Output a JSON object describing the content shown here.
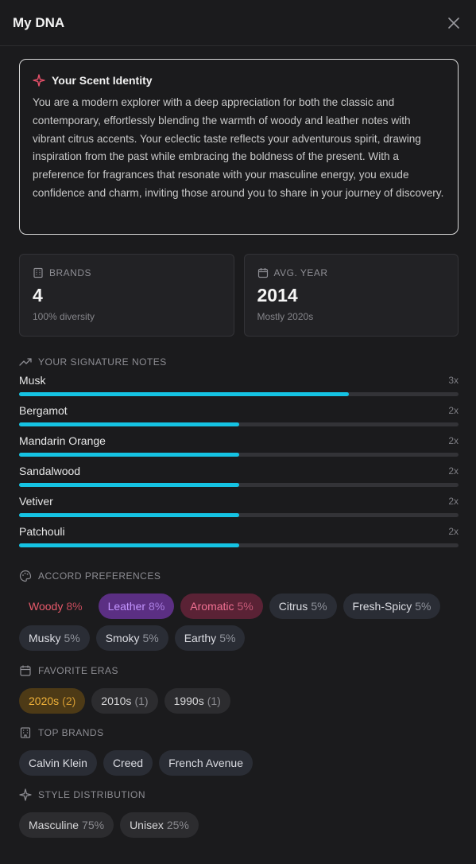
{
  "header": {
    "title": "My DNA"
  },
  "identity": {
    "title": "Your Scent Identity",
    "text": "You are a modern explorer with a deep appreciation for both the classic and contemporary, effortlessly blending the warmth of woody and leather notes with vibrant citrus accents. Your eclectic taste reflects your adventurous spirit, drawing inspiration from the past while embracing the boldness of the present. With a preference for fragrances that resonate with your masculine energy, you exude confidence and charm, inviting those around you to share in your journey of discovery."
  },
  "stats": {
    "brands": {
      "label": "Brands",
      "value": "4",
      "sub": "100% diversity"
    },
    "year": {
      "label": "Avg. Year",
      "value": "2014",
      "sub": "Mostly 2020s"
    }
  },
  "notes": {
    "title": "Your Signature Notes",
    "items": [
      {
        "name": "Musk",
        "count": "3x",
        "level": 0.75
      },
      {
        "name": "Bergamot",
        "count": "2x",
        "level": 0.5
      },
      {
        "name": "Mandarin Orange",
        "count": "2x",
        "level": 0.5
      },
      {
        "name": "Sandalwood",
        "count": "2x",
        "level": 0.5
      },
      {
        "name": "Vetiver",
        "count": "2x",
        "level": 0.5
      },
      {
        "name": "Patchouli",
        "count": "2x",
        "level": 0.5
      }
    ]
  },
  "accords": {
    "title": "Accord Preferences",
    "items": [
      {
        "name": "Woody",
        "pct": "8%"
      },
      {
        "name": "Leather",
        "pct": "8%"
      },
      {
        "name": "Aromatic",
        "pct": "5%"
      },
      {
        "name": "Citrus",
        "pct": "5%"
      },
      {
        "name": "Fresh-Spicy",
        "pct": "5%"
      },
      {
        "name": "Musky",
        "pct": "5%"
      },
      {
        "name": "Smoky",
        "pct": "5%"
      },
      {
        "name": "Earthy",
        "pct": "5%"
      }
    ]
  },
  "eras": {
    "title": "Favorite Eras",
    "items": [
      {
        "name": "2020s",
        "count": "(2)"
      },
      {
        "name": "2010s",
        "count": "(1)"
      },
      {
        "name": "1990s",
        "count": "(1)"
      }
    ]
  },
  "brands": {
    "title": "Top Brands",
    "items": [
      "Calvin Klein",
      "Creed",
      "French Avenue"
    ]
  },
  "style": {
    "title": "Style Distribution",
    "items": [
      {
        "name": "Masculine",
        "pct": "75%"
      },
      {
        "name": "Unisex",
        "pct": "25%"
      }
    ]
  },
  "colors": {
    "accent": "#15c3e3",
    "identity_icon": "#e8506a"
  }
}
